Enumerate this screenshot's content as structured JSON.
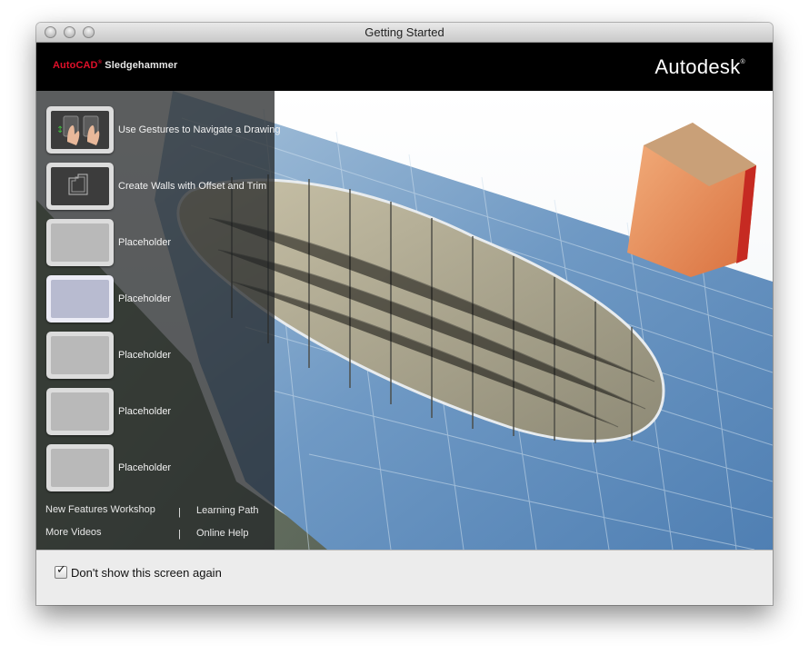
{
  "window": {
    "title": "Getting Started"
  },
  "header": {
    "product_brand": "AutoCAD",
    "product_name": "Sledgehammer",
    "company": "Autodesk",
    "company_mark": "®"
  },
  "sidebar": {
    "items": [
      {
        "label": "Use Gestures to Navigate a Drawing"
      },
      {
        "label": "Create Walls with Offset and Trim"
      },
      {
        "label": "Placeholder"
      },
      {
        "label": "Placeholder"
      },
      {
        "label": "Placeholder"
      },
      {
        "label": "Placeholder"
      },
      {
        "label": "Placeholder"
      }
    ],
    "links": {
      "new_features": "New Features Workshop",
      "learning_path": "Learning Path",
      "more_videos": "More Videos",
      "online_help": "Online Help",
      "separator": "|"
    }
  },
  "footer": {
    "checkbox_label": "Don't show this screen again",
    "checkbox_checked": true,
    "check_glyph": "✓"
  },
  "colors": {
    "brand_red": "#e0102a",
    "header_bg": "#000000",
    "sidebar_overlay": "#222426"
  }
}
